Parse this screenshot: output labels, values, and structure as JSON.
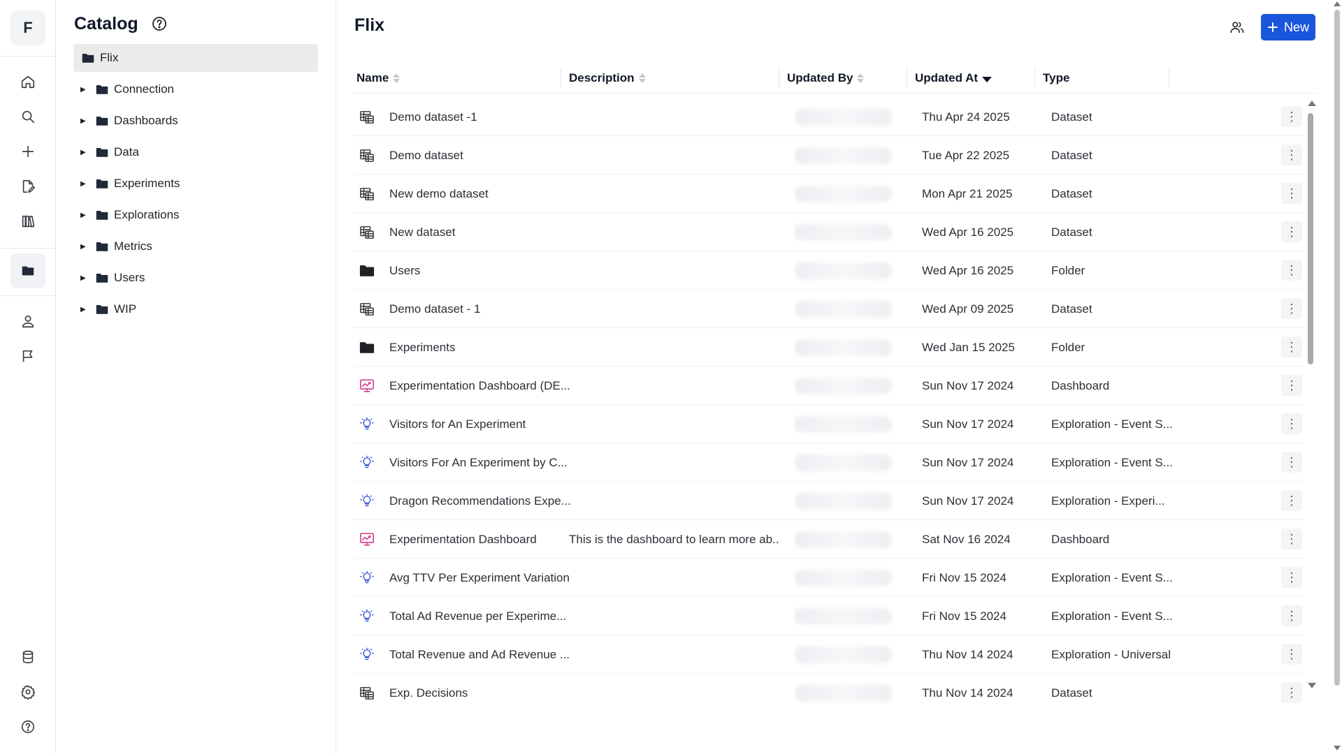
{
  "rail": {
    "logo": "F",
    "items": [
      {
        "icon": "home-icon"
      },
      {
        "icon": "search-icon"
      },
      {
        "icon": "plus-icon"
      },
      {
        "icon": "edit-document-icon"
      },
      {
        "icon": "library-icon"
      },
      {
        "icon": "folder-icon",
        "active": true
      },
      {
        "icon": "user-icon"
      },
      {
        "icon": "flag-icon"
      },
      {
        "icon": "database-icon"
      },
      {
        "icon": "gear-icon"
      },
      {
        "icon": "help-icon"
      }
    ]
  },
  "catalog": {
    "title": "Catalog",
    "root": "Flix",
    "folders": [
      "Connection",
      "Dashboards",
      "Data",
      "Experiments",
      "Explorations",
      "Metrics",
      "Users",
      "WIP"
    ]
  },
  "main": {
    "title": "Flix",
    "new_label": "New",
    "columns": {
      "name": "Name",
      "description": "Description",
      "updated_by": "Updated By",
      "updated_at": "Updated At",
      "type": "Type"
    },
    "rows": [
      {
        "icon": "dataset",
        "name": "Demo dataset -1",
        "description": "",
        "updated_at": "Thu Apr 24 2025",
        "type": "Dataset"
      },
      {
        "icon": "dataset",
        "name": "Demo dataset",
        "description": "",
        "updated_at": "Tue Apr 22 2025",
        "type": "Dataset"
      },
      {
        "icon": "dataset",
        "name": "New demo dataset",
        "description": "",
        "updated_at": "Mon Apr 21 2025",
        "type": "Dataset"
      },
      {
        "icon": "dataset",
        "name": "New dataset",
        "description": "",
        "updated_at": "Wed Apr 16 2025",
        "type": "Dataset"
      },
      {
        "icon": "folder",
        "name": "Users",
        "description": "",
        "updated_at": "Wed Apr 16 2025",
        "type": "Folder"
      },
      {
        "icon": "dataset",
        "name": "Demo dataset - 1",
        "description": "",
        "updated_at": "Wed Apr 09 2025",
        "type": "Dataset"
      },
      {
        "icon": "folder",
        "name": "Experiments",
        "description": "",
        "updated_at": "Wed Jan 15 2025",
        "type": "Folder"
      },
      {
        "icon": "dashboard",
        "name": "Experimentation Dashboard (DE...",
        "description": "",
        "updated_at": "Sun Nov 17 2024",
        "type": "Dashboard"
      },
      {
        "icon": "exploration",
        "name": "Visitors for An Experiment",
        "description": "",
        "updated_at": "Sun Nov 17 2024",
        "type": "Exploration - Event S..."
      },
      {
        "icon": "exploration",
        "name": "Visitors For An Experiment by C...",
        "description": "",
        "updated_at": "Sun Nov 17 2024",
        "type": "Exploration - Event S..."
      },
      {
        "icon": "exploration",
        "name": "Dragon Recommendations Expe...",
        "description": "",
        "updated_at": "Sun Nov 17 2024",
        "type": "Exploration - Experi..."
      },
      {
        "icon": "dashboard",
        "name": "Experimentation Dashboard",
        "description": "This is the dashboard to learn more ab...",
        "updated_at": "Sat Nov 16 2024",
        "type": "Dashboard"
      },
      {
        "icon": "exploration",
        "name": "Avg TTV Per Experiment Variation",
        "description": "",
        "updated_at": "Fri Nov 15 2024",
        "type": "Exploration - Event S..."
      },
      {
        "icon": "exploration",
        "name": "Total Ad Revenue per Experime...",
        "description": "",
        "updated_at": "Fri Nov 15 2024",
        "type": "Exploration - Event S..."
      },
      {
        "icon": "exploration",
        "name": "Total Revenue and Ad Revenue ...",
        "description": "",
        "updated_at": "Thu Nov 14 2024",
        "type": "Exploration - Universal"
      },
      {
        "icon": "dataset",
        "name": "Exp. Decisions",
        "description": "",
        "updated_at": "Thu Nov 14 2024",
        "type": "Dataset"
      }
    ]
  },
  "colors": {
    "accent": "#1a56db",
    "dashboard_icon": "#d6338a",
    "exploration_icon": "#3b5bdb"
  }
}
